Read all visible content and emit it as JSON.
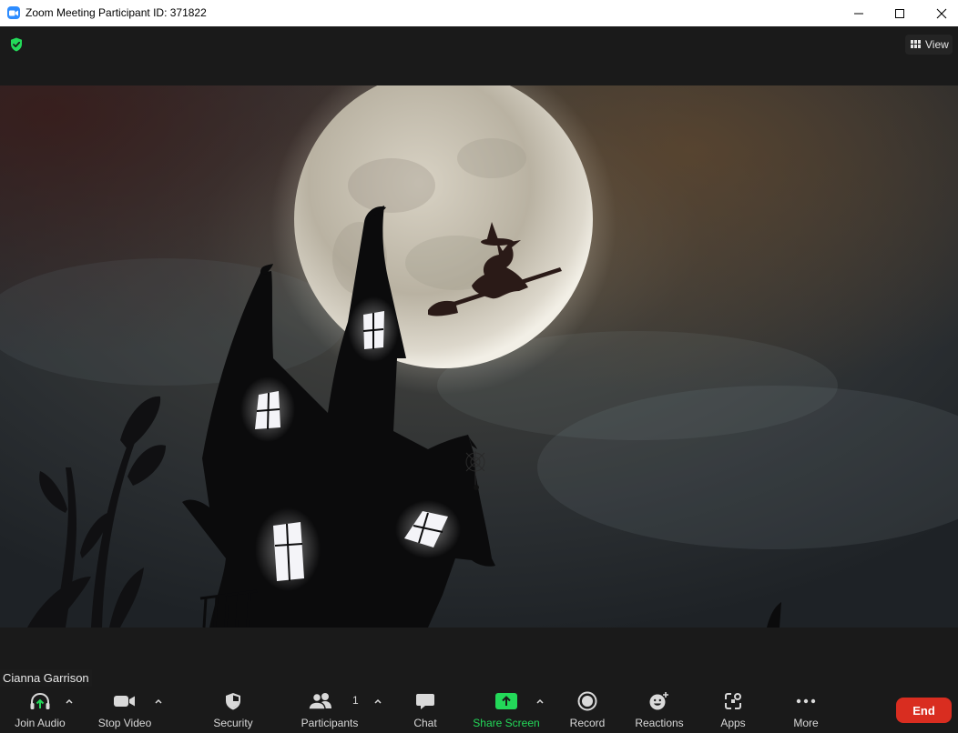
{
  "window": {
    "title": "Zoom Meeting Participant ID: 371822"
  },
  "top": {
    "view_label": "View",
    "encryption_badge_color": "#23d959"
  },
  "video": {
    "participant_name": "Cianna Garrison"
  },
  "toolbar": {
    "join_audio": "Join Audio",
    "stop_video": "Stop Video",
    "security": "Security",
    "participants": "Participants",
    "participants_count": "1",
    "chat": "Chat",
    "share_screen": "Share Screen",
    "record": "Record",
    "reactions": "Reactions",
    "apps": "Apps",
    "more": "More",
    "end": "End"
  },
  "colors": {
    "accent_green": "#23d959",
    "end_red": "#d92d20",
    "zoom_blue": "#2d8cff"
  }
}
